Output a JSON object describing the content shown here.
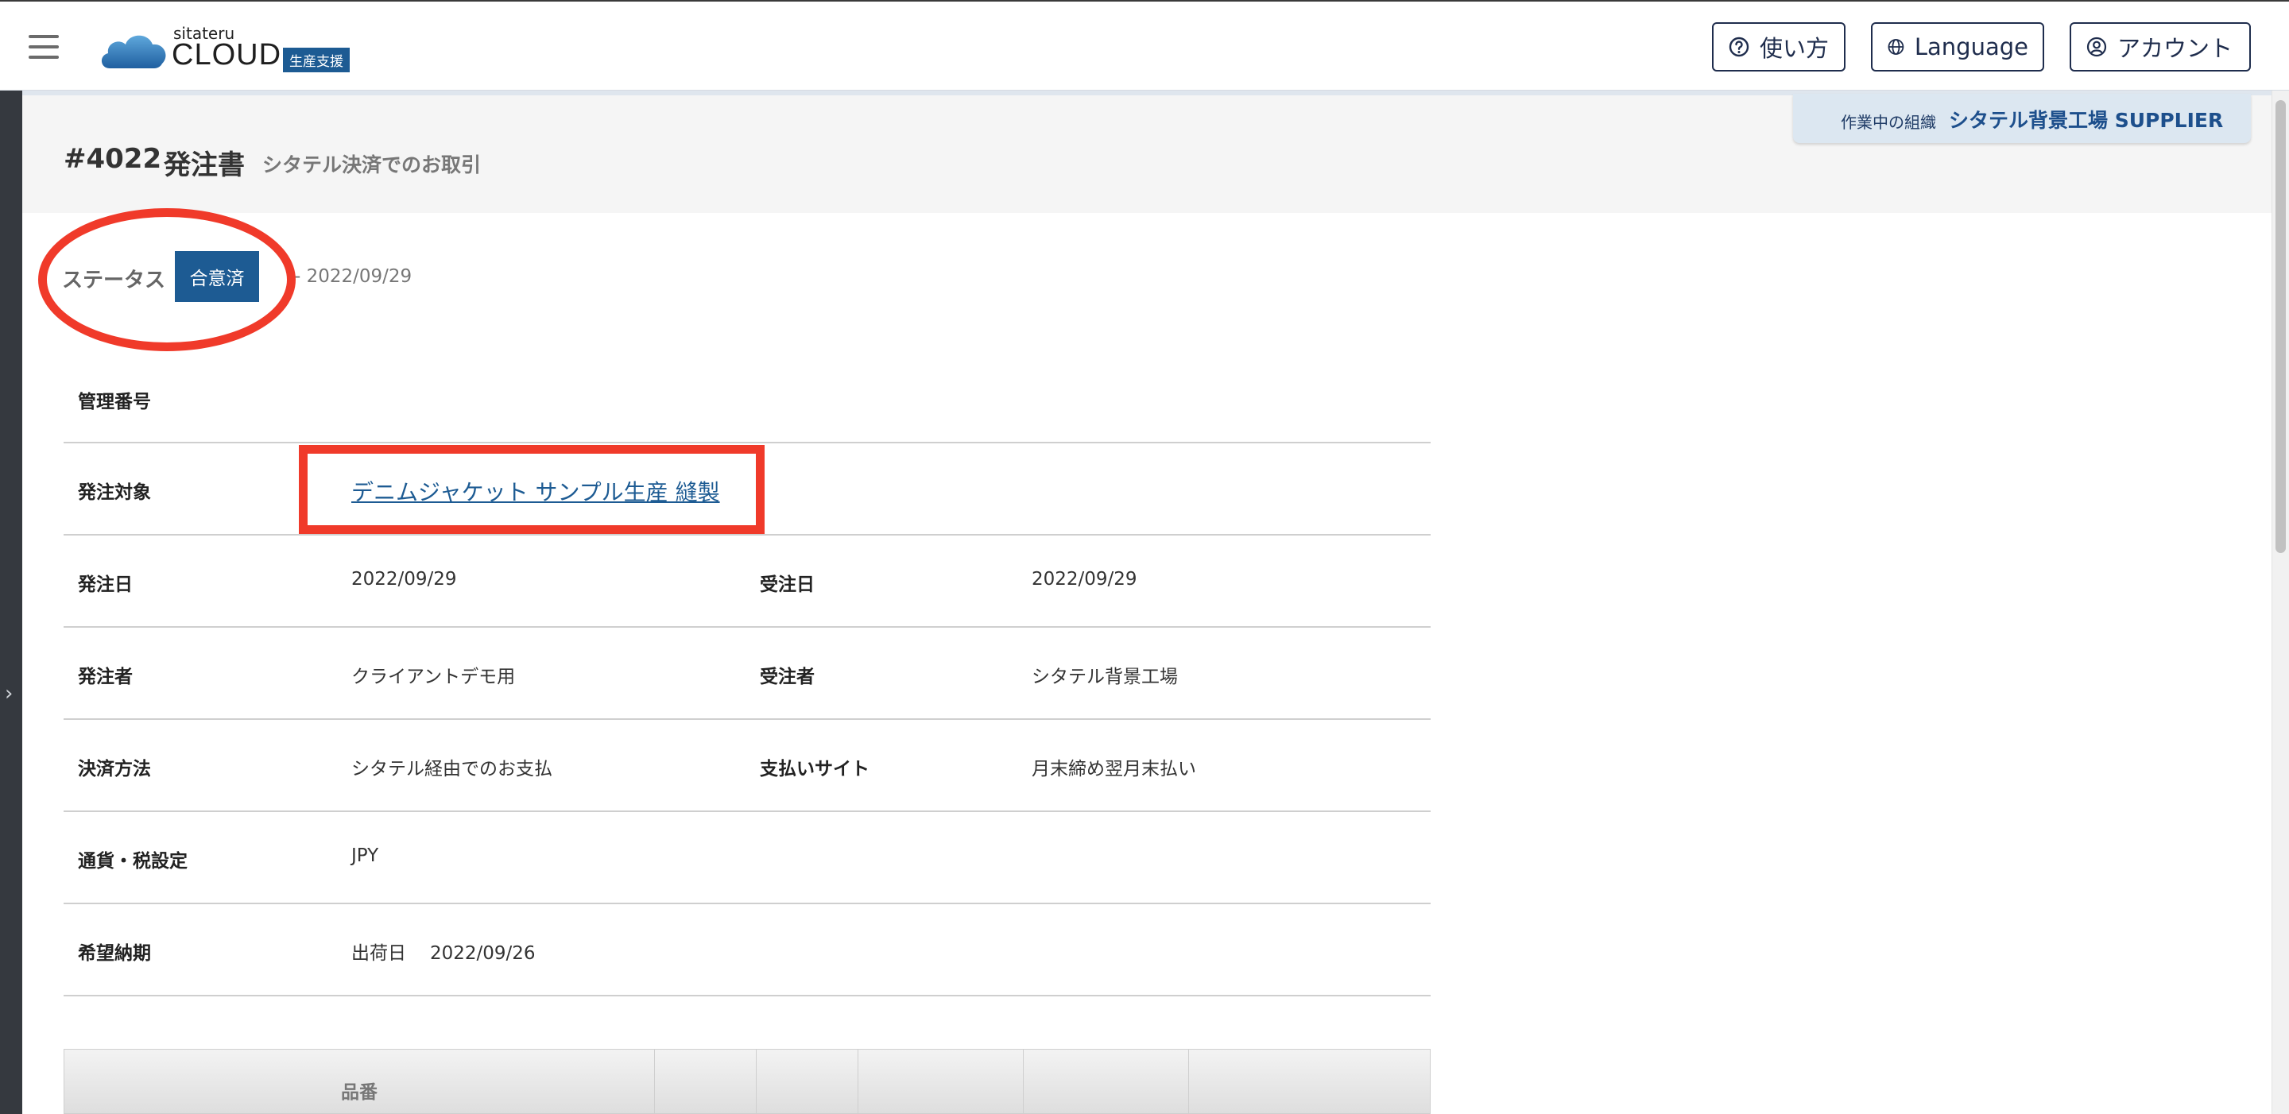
{
  "header": {
    "logo_small": "sitateru",
    "logo_big": "CLOUD",
    "logo_tag": "生産支援",
    "help_label": "使い方",
    "language_label": "Language",
    "account_label": "アカウント"
  },
  "title": {
    "number": "#4022",
    "doc_type": "発注書",
    "subtitle": "シタテル決済でのお取引"
  },
  "org": {
    "label": "作業中の組織",
    "value": "シタテル背景工場 SUPPLIER"
  },
  "status": {
    "label": "ステータス",
    "badge": "合意済",
    "date": "- 2022/09/29",
    "badge_color": "#1d5b93"
  },
  "details": {
    "management_no": {
      "label": "管理番号",
      "value": ""
    },
    "target": {
      "label": "発注対象",
      "link": "デニムジャケット サンプル生産 縫製"
    },
    "order_date": {
      "label": "発注日",
      "value": "2022/09/29"
    },
    "received_date": {
      "label": "受注日",
      "value": "2022/09/29"
    },
    "orderer": {
      "label": "発注者",
      "value": "クライアントデモ用"
    },
    "receiver": {
      "label": "受注者",
      "value": "シタテル背景工場"
    },
    "payment_method": {
      "label": "決済方法",
      "value": "シタテル経由でのお支払"
    },
    "payment_site": {
      "label": "支払いサイト",
      "value": "月末締め翌月末払い"
    },
    "currency": {
      "label": "通貨・税設定",
      "value": "JPY"
    },
    "delivery": {
      "label": "希望納期",
      "type": "出荷日",
      "date": "2022/09/26"
    }
  },
  "items_table": {
    "col_product_no": "品番"
  },
  "annotations": {
    "color": "#f03a2a"
  }
}
